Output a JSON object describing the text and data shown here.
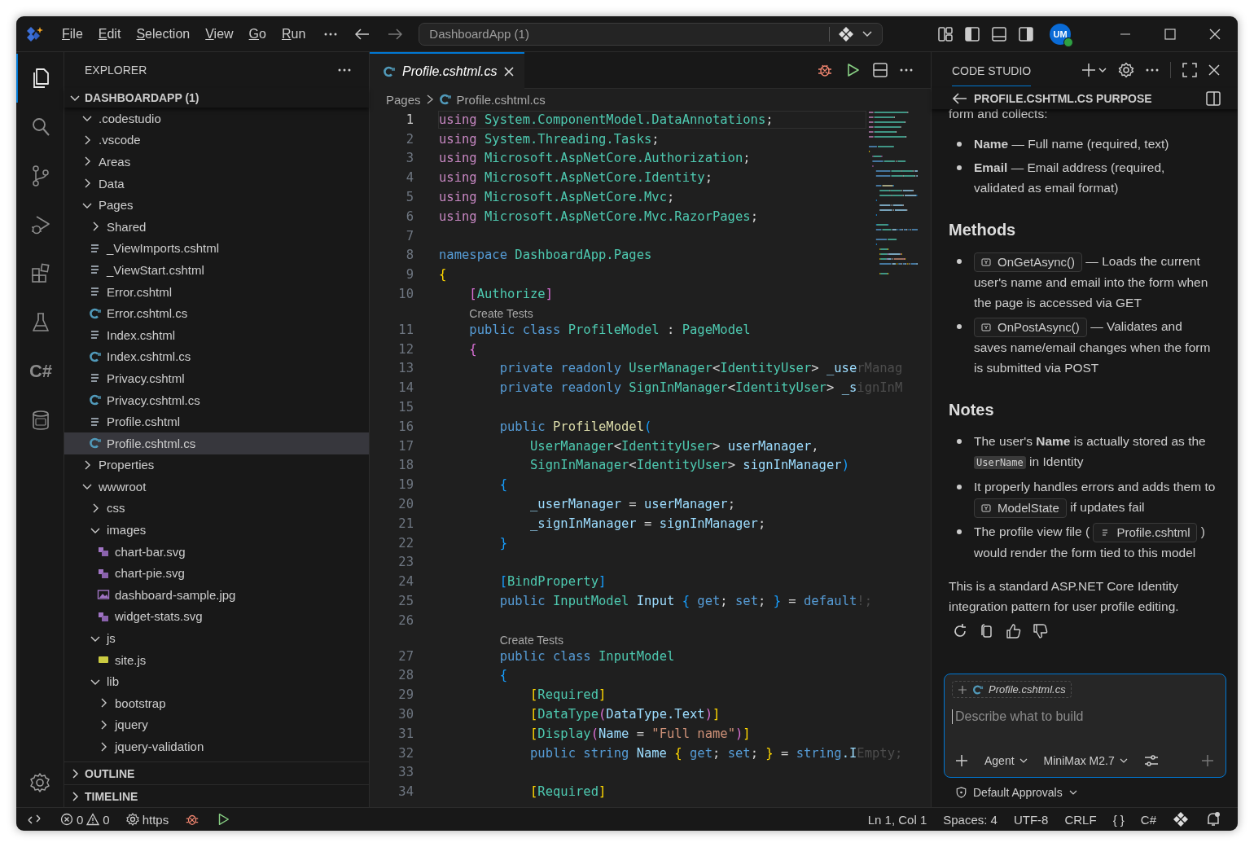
{
  "titlebar": {
    "menus": [
      "File",
      "Edit",
      "Selection",
      "View",
      "Go",
      "Run"
    ],
    "command_center": "DashboardApp (1)",
    "avatar": "UM"
  },
  "activity": [
    {
      "kind": "files",
      "selected": true
    },
    {
      "kind": "search",
      "selected": false
    },
    {
      "kind": "scm",
      "selected": false
    },
    {
      "kind": "debug",
      "selected": false
    },
    {
      "kind": "extensions",
      "selected": false
    },
    {
      "kind": "testing",
      "selected": false
    },
    {
      "kind": "text",
      "label": "C#",
      "selected": false
    },
    {
      "kind": "database",
      "selected": false
    }
  ],
  "explorer": {
    "title": "EXPLORER",
    "root": "DASHBOARDAPP (1)",
    "root_expanded": true,
    "items": [
      {
        "name": ".codestudio",
        "kind": "folder",
        "expanded": true,
        "selected": false
      },
      {
        "name": ".vscode",
        "kind": "folder",
        "expanded": false,
        "selected": false
      },
      {
        "name": "Areas",
        "kind": "folder",
        "expanded": false,
        "selected": false
      },
      {
        "name": "Data",
        "kind": "folder",
        "expanded": false,
        "selected": false
      },
      {
        "name": "Pages",
        "kind": "folder",
        "expanded": true,
        "selected": false,
        "children": [
          {
            "name": "Shared",
            "kind": "folder",
            "expanded": false,
            "selected": false
          },
          {
            "name": "_ViewImports.cshtml",
            "kind": "razor",
            "selected": false
          },
          {
            "name": "_ViewStart.cshtml",
            "kind": "razor",
            "selected": false
          },
          {
            "name": "Error.cshtml",
            "kind": "razor",
            "selected": false
          },
          {
            "name": "Error.cshtml.cs",
            "kind": "csharp",
            "selected": false
          },
          {
            "name": "Index.cshtml",
            "kind": "razor",
            "selected": false
          },
          {
            "name": "Index.cshtml.cs",
            "kind": "csharp",
            "selected": false
          },
          {
            "name": "Privacy.cshtml",
            "kind": "razor",
            "selected": false
          },
          {
            "name": "Privacy.cshtml.cs",
            "kind": "csharp",
            "selected": false
          },
          {
            "name": "Profile.cshtml",
            "kind": "razor",
            "selected": false
          },
          {
            "name": "Profile.cshtml.cs",
            "kind": "csharp",
            "selected": true
          }
        ]
      },
      {
        "name": "Properties",
        "kind": "folder",
        "expanded": false,
        "selected": false
      },
      {
        "name": "wwwroot",
        "kind": "folder",
        "expanded": true,
        "selected": false,
        "children": [
          {
            "name": "css",
            "kind": "folder",
            "expanded": false,
            "selected": false
          },
          {
            "name": "images",
            "kind": "folder",
            "expanded": true,
            "selected": false,
            "children": [
              {
                "name": "chart-bar.svg",
                "kind": "svg",
                "selected": false
              },
              {
                "name": "chart-pie.svg",
                "kind": "svg",
                "selected": false
              },
              {
                "name": "dashboard-sample.jpg",
                "kind": "image",
                "selected": false
              },
              {
                "name": "widget-stats.svg",
                "kind": "svg",
                "selected": false
              }
            ]
          },
          {
            "name": "js",
            "kind": "folder",
            "expanded": true,
            "selected": false,
            "children": [
              {
                "name": "site.js",
                "kind": "js",
                "selected": false
              }
            ]
          },
          {
            "name": "lib",
            "kind": "folder",
            "expanded": true,
            "selected": false,
            "children": [
              {
                "name": "bootstrap",
                "kind": "folder",
                "expanded": false,
                "selected": false
              },
              {
                "name": "jquery",
                "kind": "folder",
                "expanded": false,
                "selected": false
              },
              {
                "name": "jquery-validation",
                "kind": "folder",
                "expanded": false,
                "selected": false
              }
            ]
          }
        ]
      }
    ],
    "sections": [
      {
        "label": "OUTLINE",
        "expanded": false
      },
      {
        "label": "TIMELINE",
        "expanded": false
      }
    ]
  },
  "editor": {
    "tab": {
      "label": "Profile.cshtml.cs",
      "preview": true
    },
    "breadcrumbs": [
      "Pages",
      "Profile.cshtml.cs"
    ],
    "lines": [
      {
        "n": "1",
        "current": true,
        "tokens": [
          {
            "text": "using",
            "kind": "directive"
          },
          {
            "text": " System.ComponentModel.DataAnnotations",
            "kind": "type"
          },
          {
            "text": ";",
            "kind": "plain"
          }
        ]
      },
      {
        "n": "2",
        "current": false,
        "tokens": [
          {
            "text": "using",
            "kind": "directive"
          },
          {
            "text": " System.Threading.Tasks",
            "kind": "type"
          },
          {
            "text": ";",
            "kind": "plain"
          }
        ]
      },
      {
        "n": "3",
        "current": false,
        "tokens": [
          {
            "text": "using",
            "kind": "directive"
          },
          {
            "text": " Microsoft.AspNetCore.Authorization",
            "kind": "type"
          },
          {
            "text": ";",
            "kind": "plain"
          }
        ]
      },
      {
        "n": "4",
        "current": false,
        "tokens": [
          {
            "text": "using",
            "kind": "directive"
          },
          {
            "text": " Microsoft.AspNetCore.Identity",
            "kind": "type"
          },
          {
            "text": ";",
            "kind": "plain"
          }
        ]
      },
      {
        "n": "5",
        "current": false,
        "tokens": [
          {
            "text": "using",
            "kind": "directive"
          },
          {
            "text": " Microsoft.AspNetCore.Mvc",
            "kind": "type"
          },
          {
            "text": ";",
            "kind": "plain"
          }
        ]
      },
      {
        "n": "6",
        "current": false,
        "tokens": [
          {
            "text": "using",
            "kind": "directive"
          },
          {
            "text": " Microsoft.AspNetCore.Mvc.RazorPages",
            "kind": "type"
          },
          {
            "text": ";",
            "kind": "plain"
          }
        ]
      },
      {
        "n": "7",
        "current": false
      },
      {
        "n": "8",
        "current": false,
        "tokens": [
          {
            "text": "namespace",
            "kind": "keyword"
          },
          {
            "text": " DashboardApp.Pages",
            "kind": "type"
          }
        ]
      },
      {
        "n": "9",
        "current": false,
        "tokens": [
          {
            "text": "{",
            "kind": "bracket1"
          }
        ]
      },
      {
        "n": "10",
        "current": false,
        "tokens": [
          {
            "text": "    [",
            "kind": "bracket2"
          },
          {
            "text": "Authorize",
            "kind": "type"
          },
          {
            "text": "]",
            "kind": "bracket2"
          }
        ]
      },
      {
        "n": "11",
        "current": false,
        "lens": "Create Tests",
        "tokens": [
          {
            "text": "    public class",
            "kind": "keyword"
          },
          {
            "text": " ProfileModel",
            "kind": "type"
          },
          {
            "text": " : ",
            "kind": "plain"
          },
          {
            "text": "PageModel",
            "kind": "type"
          }
        ]
      },
      {
        "n": "12",
        "current": false,
        "tokens": [
          {
            "text": "    {",
            "kind": "bracket2"
          }
        ]
      },
      {
        "n": "13",
        "current": false,
        "tokens": [
          {
            "text": "        private readonly",
            "kind": "keyword"
          },
          {
            "text": " UserManager",
            "kind": "type"
          },
          {
            "text": "<",
            "kind": "plain"
          },
          {
            "text": "IdentityUser",
            "kind": "type"
          },
          {
            "text": "> ",
            "kind": "plain"
          },
          {
            "text": "_use",
            "kind": "variable"
          },
          {
            "text": "rManag",
            "kind": "ghost"
          }
        ]
      },
      {
        "n": "14",
        "current": false,
        "tokens": [
          {
            "text": "        private readonly",
            "kind": "keyword"
          },
          {
            "text": " SignInManager",
            "kind": "type"
          },
          {
            "text": "<",
            "kind": "plain"
          },
          {
            "text": "IdentityUser",
            "kind": "type"
          },
          {
            "text": "> ",
            "kind": "plain"
          },
          {
            "text": "_s",
            "kind": "variable"
          },
          {
            "text": "ignInM",
            "kind": "ghost"
          }
        ]
      },
      {
        "n": "15",
        "current": false
      },
      {
        "n": "16",
        "current": false,
        "tokens": [
          {
            "text": "        public",
            "kind": "keyword"
          },
          {
            "text": " ProfileModel",
            "kind": "function"
          },
          {
            "text": "(",
            "kind": "bracket3"
          }
        ]
      },
      {
        "n": "17",
        "current": false,
        "tokens": [
          {
            "text": "            UserManager",
            "kind": "type"
          },
          {
            "text": "<",
            "kind": "plain"
          },
          {
            "text": "IdentityUser",
            "kind": "type"
          },
          {
            "text": "> ",
            "kind": "plain"
          },
          {
            "text": "userManager",
            "kind": "variable"
          },
          {
            "text": ",",
            "kind": "plain"
          }
        ]
      },
      {
        "n": "18",
        "current": false,
        "tokens": [
          {
            "text": "            SignInManager",
            "kind": "type"
          },
          {
            "text": "<",
            "kind": "plain"
          },
          {
            "text": "IdentityUser",
            "kind": "type"
          },
          {
            "text": "> ",
            "kind": "plain"
          },
          {
            "text": "signInManager",
            "kind": "variable"
          },
          {
            "text": ")",
            "kind": "bracket3"
          }
        ]
      },
      {
        "n": "19",
        "current": false,
        "tokens": [
          {
            "text": "        {",
            "kind": "bracket3"
          }
        ]
      },
      {
        "n": "20",
        "current": false,
        "tokens": [
          {
            "text": "            _userManager",
            "kind": "variable"
          },
          {
            "text": " = ",
            "kind": "plain"
          },
          {
            "text": "userManager",
            "kind": "variable"
          },
          {
            "text": ";",
            "kind": "plain"
          }
        ]
      },
      {
        "n": "21",
        "current": false,
        "tokens": [
          {
            "text": "            _signInManager",
            "kind": "variable"
          },
          {
            "text": " = ",
            "kind": "plain"
          },
          {
            "text": "signInManager",
            "kind": "variable"
          },
          {
            "text": ";",
            "kind": "plain"
          }
        ]
      },
      {
        "n": "22",
        "current": false,
        "tokens": [
          {
            "text": "        }",
            "kind": "bracket3"
          }
        ]
      },
      {
        "n": "23",
        "current": false
      },
      {
        "n": "24",
        "current": false,
        "tokens": [
          {
            "text": "        [",
            "kind": "bracket3"
          },
          {
            "text": "BindProperty",
            "kind": "type"
          },
          {
            "text": "]",
            "kind": "bracket3"
          }
        ]
      },
      {
        "n": "25",
        "current": false,
        "tokens": [
          {
            "text": "        public",
            "kind": "keyword"
          },
          {
            "text": " InputModel",
            "kind": "type"
          },
          {
            "text": " Input ",
            "kind": "variable"
          },
          {
            "text": "{",
            "kind": "bracket3"
          },
          {
            "text": " get",
            "kind": "keyword"
          },
          {
            "text": "; ",
            "kind": "plain"
          },
          {
            "text": "set",
            "kind": "keyword"
          },
          {
            "text": "; ",
            "kind": "plain"
          },
          {
            "text": "}",
            "kind": "bracket3"
          },
          {
            "text": " = ",
            "kind": "plain"
          },
          {
            "text": "default",
            "kind": "keyword"
          },
          {
            "text": "!;",
            "kind": "ghost"
          }
        ]
      },
      {
        "n": "26",
        "current": false
      },
      {
        "n": "27",
        "current": false,
        "lens": "Create Tests",
        "tokens": [
          {
            "text": "        public class",
            "kind": "keyword"
          },
          {
            "text": " InputModel",
            "kind": "type"
          }
        ]
      },
      {
        "n": "28",
        "current": false,
        "tokens": [
          {
            "text": "        {",
            "kind": "bracket3"
          }
        ]
      },
      {
        "n": "29",
        "current": false,
        "tokens": [
          {
            "text": "            [",
            "kind": "bracket1"
          },
          {
            "text": "Required",
            "kind": "type"
          },
          {
            "text": "]",
            "kind": "bracket1"
          }
        ]
      },
      {
        "n": "30",
        "current": false,
        "tokens": [
          {
            "text": "            [",
            "kind": "bracket1"
          },
          {
            "text": "DataType",
            "kind": "type"
          },
          {
            "text": "(",
            "kind": "bracket2"
          },
          {
            "text": "DataType.Text",
            "kind": "variable"
          },
          {
            "text": ")",
            "kind": "bracket2"
          },
          {
            "text": "]",
            "kind": "bracket1"
          }
        ]
      },
      {
        "n": "31",
        "current": false,
        "tokens": [
          {
            "text": "            [",
            "kind": "bracket1"
          },
          {
            "text": "Display",
            "kind": "type"
          },
          {
            "text": "(",
            "kind": "bracket2"
          },
          {
            "text": "Name",
            "kind": "variable"
          },
          {
            "text": " = ",
            "kind": "plain"
          },
          {
            "text": "\"Full name\"",
            "kind": "string"
          },
          {
            "text": ")",
            "kind": "bracket2"
          },
          {
            "text": "]",
            "kind": "bracket1"
          }
        ]
      },
      {
        "n": "32",
        "current": false,
        "tokens": [
          {
            "text": "            public string",
            "kind": "keyword"
          },
          {
            "text": " Name ",
            "kind": "variable"
          },
          {
            "text": "{",
            "kind": "bracket1"
          },
          {
            "text": " get",
            "kind": "keyword"
          },
          {
            "text": "; ",
            "kind": "plain"
          },
          {
            "text": "set",
            "kind": "keyword"
          },
          {
            "text": "; ",
            "kind": "plain"
          },
          {
            "text": "}",
            "kind": "bracket1"
          },
          {
            "text": " = ",
            "kind": "plain"
          },
          {
            "text": "string",
            "kind": "keyword"
          },
          {
            "text": ".I",
            "kind": "variable"
          },
          {
            "text": "Empty;",
            "kind": "ghost"
          }
        ]
      },
      {
        "n": "33",
        "current": false
      },
      {
        "n": "34",
        "current": false,
        "tokens": [
          {
            "text": "            [",
            "kind": "bracket1"
          },
          {
            "text": "Required",
            "kind": "type"
          },
          {
            "text": "]",
            "kind": "bracket1"
          }
        ]
      }
    ]
  },
  "panel": {
    "title": "CODE STUDIO",
    "subtitle": "PROFILE.CSHTML.CS PURPOSE",
    "intro": "form and collects:",
    "fields": [
      "**Name** — Full name (required, text)",
      "**Email** — Email address (required, validated as email format)"
    ],
    "sections": [
      {
        "heading": "Methods",
        "bullets": [
          [
            {
              "kind": "symbol",
              "text": "OnGetAsync()"
            },
            {
              "kind": "text",
              "text": "— Loads the current user's name and email into the form when the page is accessed via GET"
            }
          ],
          [
            {
              "kind": "symbol",
              "text": "OnPostAsync()"
            },
            {
              "kind": "text",
              "text": "— Validates and saves name/email changes when the form is submitted via POST"
            }
          ]
        ]
      },
      {
        "heading": "Notes",
        "bullets": [
          [
            {
              "kind": "text",
              "text": "The user's **Name** is actually stored as the"
            },
            {
              "kind": "code",
              "text": "UserName"
            },
            {
              "kind": "text",
              "text": "in Identity"
            }
          ],
          [
            {
              "kind": "text",
              "text": "It properly handles errors and adds them to"
            },
            {
              "kind": "symbol",
              "text": "ModelState"
            },
            {
              "kind": "text",
              "text": "if updates fail"
            }
          ],
          [
            {
              "kind": "text",
              "text": "The profile view file ("
            },
            {
              "kind": "file",
              "text": "Profile.cshtml"
            },
            {
              "kind": "text",
              "text": ")"
            },
            {
              "kind": "text",
              "text": "would render the form tied to this model"
            }
          ]
        ]
      }
    ],
    "summary": "This is a standard ASP.NET Core Identity integration pattern for user profile editing.",
    "input": {
      "context": "Profile.cshtml.cs",
      "placeholder": "Describe what to build",
      "mode": "Agent",
      "model": "MiniMax M2.7"
    },
    "approvals": "Default Approvals"
  },
  "status": {
    "errors": "0",
    "warnings": "0",
    "remote": "https",
    "cursor": "Ln 1, Col 1",
    "spaces": "Spaces: 4",
    "encoding": "UTF-8",
    "eol": "CRLF",
    "braces": "{ }",
    "language": "C#"
  }
}
